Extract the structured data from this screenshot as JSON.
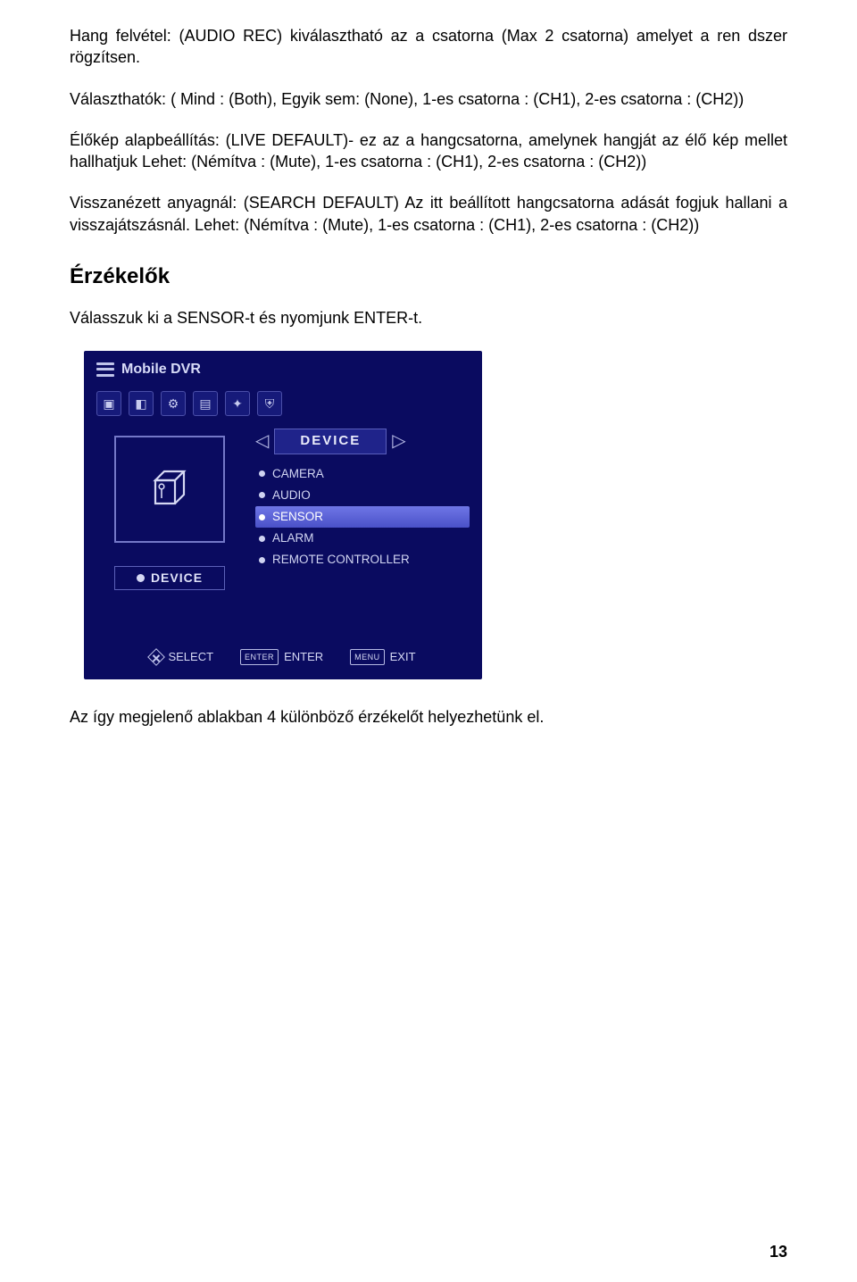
{
  "paragraphs": {
    "p1": "Hang felvétel: (AUDIO REC) kiválasztható az a csatorna (Max 2 csatorna) amelyet a ren dszer rögzítsen.",
    "p2": "Választhatók: ( Mind : (Both), Egyik sem: (None), 1-es csatorna : (CH1), 2-es csatorna : (CH2))",
    "p3": "Élőkép alapbeállítás: (LIVE DEFAULT)- ez az a hangcsatorna, amelynek hangját az élő kép mellet hallhatjuk Lehet: (Némítva : (Mute), 1-es csatorna : (CH1), 2-es csatorna : (CH2))",
    "p4": "Visszanézett anyagnál: (SEARCH DEFAULT) Az itt beállított hangcsatorna adását fogjuk hallani a visszajátszásnál. Lehet: (Némítva : (Mute), 1-es csatorna : (CH1), 2-es csatorna : (CH2))",
    "p5": "Válasszuk ki a SENSOR-t és nyomjunk ENTER-t.",
    "p6": "Az így megjelenő ablakban 4 különböző érzékelőt helyezhetünk el."
  },
  "section_title": "Érzékelők",
  "dvr": {
    "title": "Mobile DVR",
    "tab_label": "DEVICE",
    "device_label": "DEVICE",
    "menu": [
      "CAMERA",
      "AUDIO",
      "SENSOR",
      "ALARM",
      "REMOTE CONTROLLER"
    ],
    "selected_index": 2,
    "footer": {
      "select": "SELECT",
      "enter_key": "ENTER",
      "enter_label": "ENTER",
      "menu_key": "MENU",
      "exit_label": "EXIT"
    }
  },
  "page_number": "13"
}
